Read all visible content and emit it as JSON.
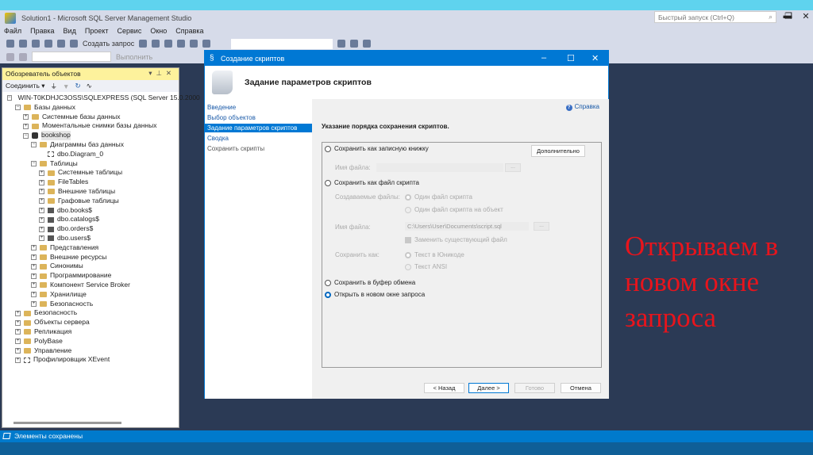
{
  "app": {
    "title": "Solution1 - Microsoft SQL Server Management Studio",
    "quick_launch_placeholder": "Быстрый запуск (Ctrl+Q)"
  },
  "menu": [
    "Файл",
    "Правка",
    "Вид",
    "Проект",
    "Сервис",
    "Окно",
    "Справка"
  ],
  "toolbar": {
    "new_query": "Создать запрос",
    "execute": "Выполнить"
  },
  "object_explorer": {
    "title": "Обозреватель объектов",
    "connect": "Соединить",
    "tree": [
      {
        "label": "WIN-T0KDHJC3OSS\\SQLEXPRESS (SQL Server 15.0.2000",
        "level": 0,
        "icon": "server",
        "exp": "-"
      },
      {
        "label": "Базы данных",
        "level": 1,
        "icon": "folder",
        "exp": "-"
      },
      {
        "label": "Системные базы данных",
        "level": 2,
        "icon": "folder",
        "exp": "+"
      },
      {
        "label": "Моментальные снимки базы данных",
        "level": 2,
        "icon": "folder",
        "exp": "+"
      },
      {
        "label": "bookshop",
        "level": 2,
        "icon": "database",
        "exp": "-"
      },
      {
        "label": "Диаграммы баз данных",
        "level": 3,
        "icon": "folder",
        "exp": "-"
      },
      {
        "label": "dbo.Diagram_0",
        "level": 4,
        "icon": "diagram",
        "exp": ""
      },
      {
        "label": "Таблицы",
        "level": 3,
        "icon": "folder",
        "exp": "-"
      },
      {
        "label": "Системные таблицы",
        "level": 4,
        "icon": "folder",
        "exp": "+"
      },
      {
        "label": "FileTables",
        "level": 4,
        "icon": "folder",
        "exp": "+"
      },
      {
        "label": "Внешние таблицы",
        "level": 4,
        "icon": "folder",
        "exp": "+"
      },
      {
        "label": "Графовые таблицы",
        "level": 4,
        "icon": "folder",
        "exp": "+"
      },
      {
        "label": "dbo.books$",
        "level": 4,
        "icon": "table",
        "exp": "+"
      },
      {
        "label": "dbo.catalogs$",
        "level": 4,
        "icon": "table",
        "exp": "+"
      },
      {
        "label": "dbo.orders$",
        "level": 4,
        "icon": "table",
        "exp": "+"
      },
      {
        "label": "dbo.users$",
        "level": 4,
        "icon": "table",
        "exp": "+"
      },
      {
        "label": "Представления",
        "level": 3,
        "icon": "folder",
        "exp": "+"
      },
      {
        "label": "Внешние ресурсы",
        "level": 3,
        "icon": "folder",
        "exp": "+"
      },
      {
        "label": "Синонимы",
        "level": 3,
        "icon": "folder",
        "exp": "+"
      },
      {
        "label": "Программирование",
        "level": 3,
        "icon": "folder",
        "exp": "+"
      },
      {
        "label": "Компонент Service Broker",
        "level": 3,
        "icon": "folder",
        "exp": "+"
      },
      {
        "label": "Хранилище",
        "level": 3,
        "icon": "folder",
        "exp": "+"
      },
      {
        "label": "Безопасность",
        "level": 3,
        "icon": "folder",
        "exp": "+"
      },
      {
        "label": "Безопасность",
        "level": 1,
        "icon": "folder",
        "exp": "+"
      },
      {
        "label": "Объекты сервера",
        "level": 1,
        "icon": "folder",
        "exp": "+"
      },
      {
        "label": "Репликация",
        "level": 1,
        "icon": "folder",
        "exp": "+"
      },
      {
        "label": "PolyBase",
        "level": 1,
        "icon": "folder",
        "exp": "+"
      },
      {
        "label": "Управление",
        "level": 1,
        "icon": "folder",
        "exp": "+"
      },
      {
        "label": "Профилировщик XEvent",
        "level": 1,
        "icon": "xevent",
        "exp": "+"
      }
    ]
  },
  "dialog": {
    "title": "Создание скриптов",
    "header": "Задание параметров скриптов",
    "nav": [
      {
        "label": "Введение",
        "state": "link"
      },
      {
        "label": "Выбор объектов",
        "state": "link"
      },
      {
        "label": "Задание параметров скриптов",
        "state": "selected"
      },
      {
        "label": "Сводка",
        "state": "link"
      },
      {
        "label": "Сохранить скрипты",
        "state": "disabled"
      }
    ],
    "help": "Справка",
    "instruction": "Указание порядка сохранения скриптов.",
    "opt_notebook": "Сохранить как записную книжку",
    "advanced": "Дополнительно",
    "file_name_label": "Имя файла:",
    "opt_script_file": "Сохранить как файл скрипта",
    "files_label": "Создаваемые файлы:",
    "one_file": "Один файл скрипта",
    "file_per_object": "Один файл скрипта на объект",
    "file_path": "C:\\Users\\User\\Documents\\script.sql",
    "browse": "...",
    "overwrite": "Заменить существующий файл",
    "save_as_label": "Сохранить как:",
    "unicode": "Текст в Юникоде",
    "ansi": "Текст ANSI",
    "opt_clipboard": "Сохранить в буфер обмена",
    "opt_new_window": "Открыть в новом окне запроса",
    "back": "< Назад",
    "next": "Далее >",
    "finish": "Готово",
    "cancel": "Отмена"
  },
  "status": "Элементы сохранены",
  "overlay": "Открываем в новом окне запроса",
  "colors": {
    "accent": "#0078d4",
    "overlay": "#e8141c",
    "background": "#2b3a55"
  }
}
